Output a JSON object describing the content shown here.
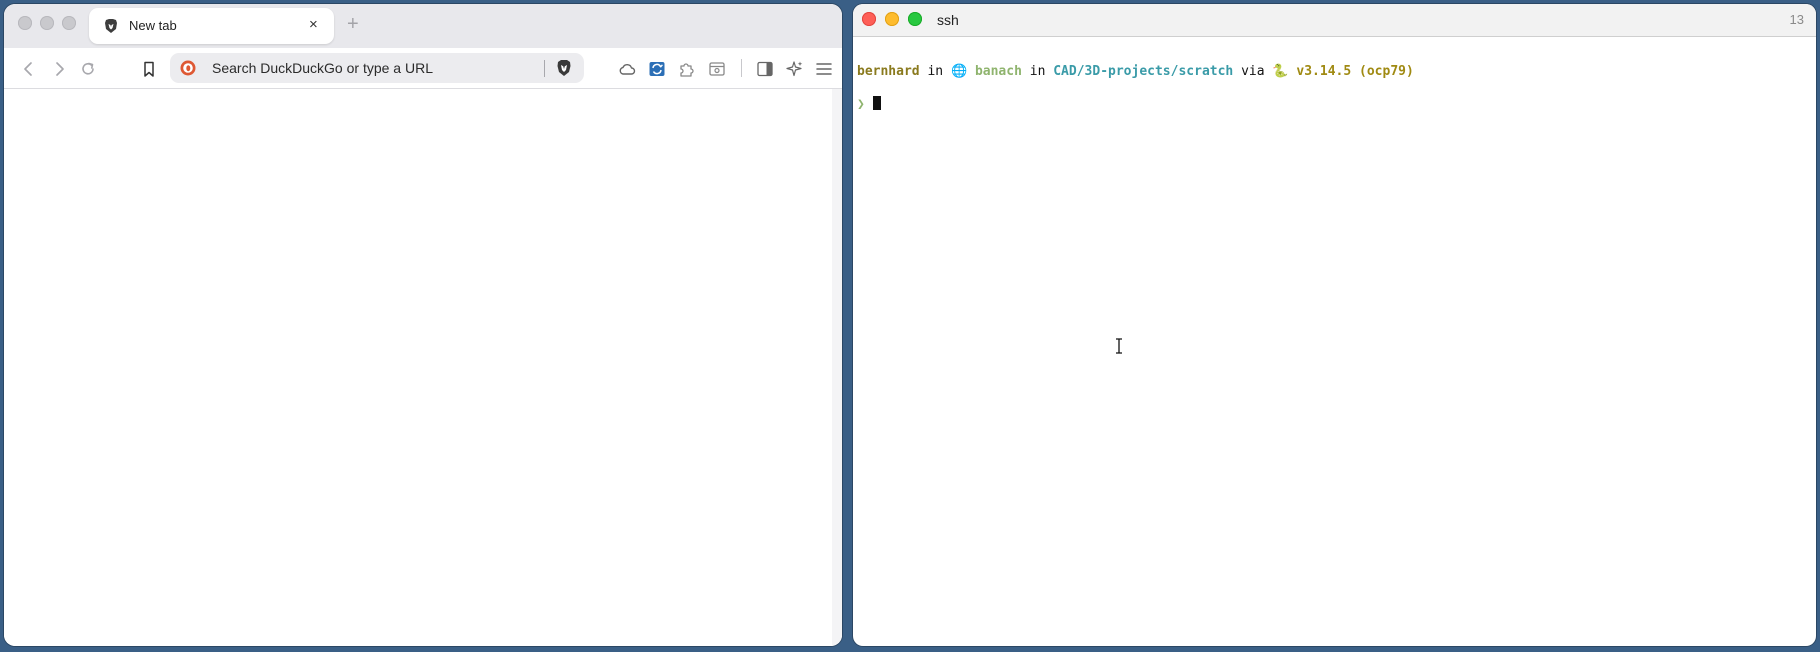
{
  "browser": {
    "tab": {
      "title": "New tab",
      "close_glyph": "×",
      "icon": "brave-lion-icon"
    },
    "new_tab_glyph": "+",
    "toolbar": {
      "back_icon": "chevron-left-icon",
      "forward_icon": "chevron-right-icon",
      "reload_icon": "reload-icon",
      "bookmark_icon": "bookmark-icon"
    },
    "urlbar": {
      "placeholder": "Search DuckDuckGo or type a URL",
      "search_engine_icon": "duckduckgo-icon",
      "shields_icon": "brave-shields-icon"
    },
    "extensions": [
      "cloud-icon",
      "translate-icon",
      "puzzle-icon",
      "wallet-icon",
      "sidebar-icon",
      "leo-ai-icon",
      "menu-icon"
    ]
  },
  "terminal": {
    "title": "ssh",
    "counter": "13",
    "prompt": {
      "user": "bernhard",
      "in1": " in ",
      "host_icon": "🌐",
      "host": " banach",
      "in2": " in ",
      "path": "CAD/3D-projects/scratch",
      "via": " via ",
      "python_icon": "🐍",
      "version": " v3.14.5 (ocp79)",
      "arrow": "❯"
    }
  },
  "colors": {
    "desktop": "#3a5f86",
    "traffic_close": "#fe5f57",
    "traffic_minimize": "#febc2e",
    "traffic_maximize": "#28c840"
  }
}
